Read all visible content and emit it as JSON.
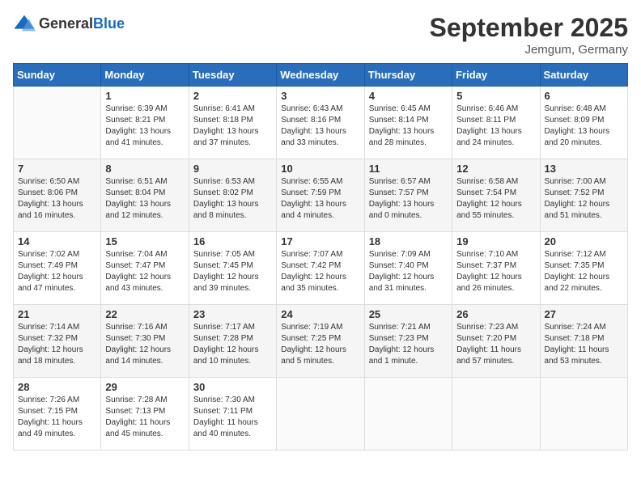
{
  "logo": {
    "general": "General",
    "blue": "Blue"
  },
  "header": {
    "month": "September 2025",
    "location": "Jemgum, Germany"
  },
  "weekdays": [
    "Sunday",
    "Monday",
    "Tuesday",
    "Wednesday",
    "Thursday",
    "Friday",
    "Saturday"
  ],
  "weeks": [
    [
      {
        "day": "",
        "info": ""
      },
      {
        "day": "1",
        "info": "Sunrise: 6:39 AM\nSunset: 8:21 PM\nDaylight: 13 hours\nand 41 minutes."
      },
      {
        "day": "2",
        "info": "Sunrise: 6:41 AM\nSunset: 8:18 PM\nDaylight: 13 hours\nand 37 minutes."
      },
      {
        "day": "3",
        "info": "Sunrise: 6:43 AM\nSunset: 8:16 PM\nDaylight: 13 hours\nand 33 minutes."
      },
      {
        "day": "4",
        "info": "Sunrise: 6:45 AM\nSunset: 8:14 PM\nDaylight: 13 hours\nand 28 minutes."
      },
      {
        "day": "5",
        "info": "Sunrise: 6:46 AM\nSunset: 8:11 PM\nDaylight: 13 hours\nand 24 minutes."
      },
      {
        "day": "6",
        "info": "Sunrise: 6:48 AM\nSunset: 8:09 PM\nDaylight: 13 hours\nand 20 minutes."
      }
    ],
    [
      {
        "day": "7",
        "info": "Sunrise: 6:50 AM\nSunset: 8:06 PM\nDaylight: 13 hours\nand 16 minutes."
      },
      {
        "day": "8",
        "info": "Sunrise: 6:51 AM\nSunset: 8:04 PM\nDaylight: 13 hours\nand 12 minutes."
      },
      {
        "day": "9",
        "info": "Sunrise: 6:53 AM\nSunset: 8:02 PM\nDaylight: 13 hours\nand 8 minutes."
      },
      {
        "day": "10",
        "info": "Sunrise: 6:55 AM\nSunset: 7:59 PM\nDaylight: 13 hours\nand 4 minutes."
      },
      {
        "day": "11",
        "info": "Sunrise: 6:57 AM\nSunset: 7:57 PM\nDaylight: 13 hours\nand 0 minutes."
      },
      {
        "day": "12",
        "info": "Sunrise: 6:58 AM\nSunset: 7:54 PM\nDaylight: 12 hours\nand 55 minutes."
      },
      {
        "day": "13",
        "info": "Sunrise: 7:00 AM\nSunset: 7:52 PM\nDaylight: 12 hours\nand 51 minutes."
      }
    ],
    [
      {
        "day": "14",
        "info": "Sunrise: 7:02 AM\nSunset: 7:49 PM\nDaylight: 12 hours\nand 47 minutes."
      },
      {
        "day": "15",
        "info": "Sunrise: 7:04 AM\nSunset: 7:47 PM\nDaylight: 12 hours\nand 43 minutes."
      },
      {
        "day": "16",
        "info": "Sunrise: 7:05 AM\nSunset: 7:45 PM\nDaylight: 12 hours\nand 39 minutes."
      },
      {
        "day": "17",
        "info": "Sunrise: 7:07 AM\nSunset: 7:42 PM\nDaylight: 12 hours\nand 35 minutes."
      },
      {
        "day": "18",
        "info": "Sunrise: 7:09 AM\nSunset: 7:40 PM\nDaylight: 12 hours\nand 31 minutes."
      },
      {
        "day": "19",
        "info": "Sunrise: 7:10 AM\nSunset: 7:37 PM\nDaylight: 12 hours\nand 26 minutes."
      },
      {
        "day": "20",
        "info": "Sunrise: 7:12 AM\nSunset: 7:35 PM\nDaylight: 12 hours\nand 22 minutes."
      }
    ],
    [
      {
        "day": "21",
        "info": "Sunrise: 7:14 AM\nSunset: 7:32 PM\nDaylight: 12 hours\nand 18 minutes."
      },
      {
        "day": "22",
        "info": "Sunrise: 7:16 AM\nSunset: 7:30 PM\nDaylight: 12 hours\nand 14 minutes."
      },
      {
        "day": "23",
        "info": "Sunrise: 7:17 AM\nSunset: 7:28 PM\nDaylight: 12 hours\nand 10 minutes."
      },
      {
        "day": "24",
        "info": "Sunrise: 7:19 AM\nSunset: 7:25 PM\nDaylight: 12 hours\nand 5 minutes."
      },
      {
        "day": "25",
        "info": "Sunrise: 7:21 AM\nSunset: 7:23 PM\nDaylight: 12 hours\nand 1 minute."
      },
      {
        "day": "26",
        "info": "Sunrise: 7:23 AM\nSunset: 7:20 PM\nDaylight: 11 hours\nand 57 minutes."
      },
      {
        "day": "27",
        "info": "Sunrise: 7:24 AM\nSunset: 7:18 PM\nDaylight: 11 hours\nand 53 minutes."
      }
    ],
    [
      {
        "day": "28",
        "info": "Sunrise: 7:26 AM\nSunset: 7:15 PM\nDaylight: 11 hours\nand 49 minutes."
      },
      {
        "day": "29",
        "info": "Sunrise: 7:28 AM\nSunset: 7:13 PM\nDaylight: 11 hours\nand 45 minutes."
      },
      {
        "day": "30",
        "info": "Sunrise: 7:30 AM\nSunset: 7:11 PM\nDaylight: 11 hours\nand 40 minutes."
      },
      {
        "day": "",
        "info": ""
      },
      {
        "day": "",
        "info": ""
      },
      {
        "day": "",
        "info": ""
      },
      {
        "day": "",
        "info": ""
      }
    ]
  ]
}
